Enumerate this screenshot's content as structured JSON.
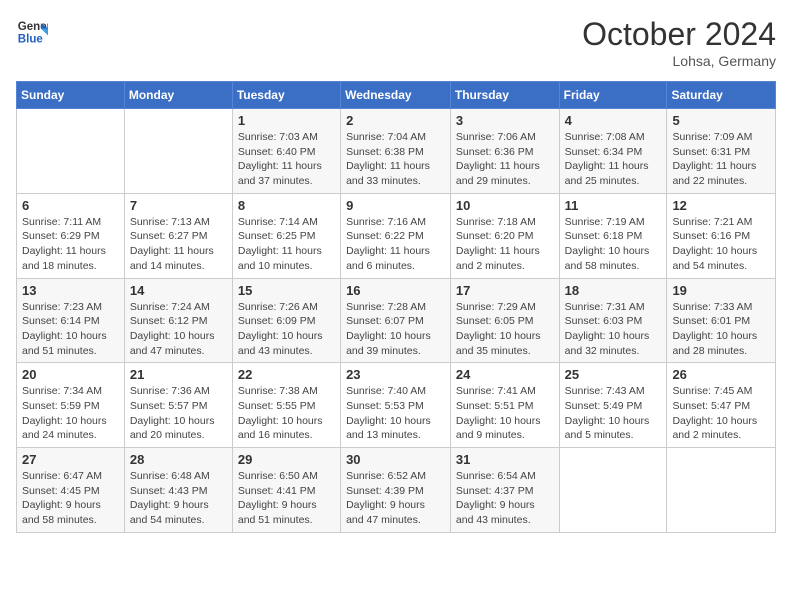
{
  "header": {
    "logo_line1": "General",
    "logo_line2": "Blue",
    "month": "October 2024",
    "location": "Lohsa, Germany"
  },
  "weekdays": [
    "Sunday",
    "Monday",
    "Tuesday",
    "Wednesday",
    "Thursday",
    "Friday",
    "Saturday"
  ],
  "weeks": [
    [
      {
        "day": "",
        "info": ""
      },
      {
        "day": "",
        "info": ""
      },
      {
        "day": "1",
        "info": "Sunrise: 7:03 AM\nSunset: 6:40 PM\nDaylight: 11 hours and 37 minutes."
      },
      {
        "day": "2",
        "info": "Sunrise: 7:04 AM\nSunset: 6:38 PM\nDaylight: 11 hours and 33 minutes."
      },
      {
        "day": "3",
        "info": "Sunrise: 7:06 AM\nSunset: 6:36 PM\nDaylight: 11 hours and 29 minutes."
      },
      {
        "day": "4",
        "info": "Sunrise: 7:08 AM\nSunset: 6:34 PM\nDaylight: 11 hours and 25 minutes."
      },
      {
        "day": "5",
        "info": "Sunrise: 7:09 AM\nSunset: 6:31 PM\nDaylight: 11 hours and 22 minutes."
      }
    ],
    [
      {
        "day": "6",
        "info": "Sunrise: 7:11 AM\nSunset: 6:29 PM\nDaylight: 11 hours and 18 minutes."
      },
      {
        "day": "7",
        "info": "Sunrise: 7:13 AM\nSunset: 6:27 PM\nDaylight: 11 hours and 14 minutes."
      },
      {
        "day": "8",
        "info": "Sunrise: 7:14 AM\nSunset: 6:25 PM\nDaylight: 11 hours and 10 minutes."
      },
      {
        "day": "9",
        "info": "Sunrise: 7:16 AM\nSunset: 6:22 PM\nDaylight: 11 hours and 6 minutes."
      },
      {
        "day": "10",
        "info": "Sunrise: 7:18 AM\nSunset: 6:20 PM\nDaylight: 11 hours and 2 minutes."
      },
      {
        "day": "11",
        "info": "Sunrise: 7:19 AM\nSunset: 6:18 PM\nDaylight: 10 hours and 58 minutes."
      },
      {
        "day": "12",
        "info": "Sunrise: 7:21 AM\nSunset: 6:16 PM\nDaylight: 10 hours and 54 minutes."
      }
    ],
    [
      {
        "day": "13",
        "info": "Sunrise: 7:23 AM\nSunset: 6:14 PM\nDaylight: 10 hours and 51 minutes."
      },
      {
        "day": "14",
        "info": "Sunrise: 7:24 AM\nSunset: 6:12 PM\nDaylight: 10 hours and 47 minutes."
      },
      {
        "day": "15",
        "info": "Sunrise: 7:26 AM\nSunset: 6:09 PM\nDaylight: 10 hours and 43 minutes."
      },
      {
        "day": "16",
        "info": "Sunrise: 7:28 AM\nSunset: 6:07 PM\nDaylight: 10 hours and 39 minutes."
      },
      {
        "day": "17",
        "info": "Sunrise: 7:29 AM\nSunset: 6:05 PM\nDaylight: 10 hours and 35 minutes."
      },
      {
        "day": "18",
        "info": "Sunrise: 7:31 AM\nSunset: 6:03 PM\nDaylight: 10 hours and 32 minutes."
      },
      {
        "day": "19",
        "info": "Sunrise: 7:33 AM\nSunset: 6:01 PM\nDaylight: 10 hours and 28 minutes."
      }
    ],
    [
      {
        "day": "20",
        "info": "Sunrise: 7:34 AM\nSunset: 5:59 PM\nDaylight: 10 hours and 24 minutes."
      },
      {
        "day": "21",
        "info": "Sunrise: 7:36 AM\nSunset: 5:57 PM\nDaylight: 10 hours and 20 minutes."
      },
      {
        "day": "22",
        "info": "Sunrise: 7:38 AM\nSunset: 5:55 PM\nDaylight: 10 hours and 16 minutes."
      },
      {
        "day": "23",
        "info": "Sunrise: 7:40 AM\nSunset: 5:53 PM\nDaylight: 10 hours and 13 minutes."
      },
      {
        "day": "24",
        "info": "Sunrise: 7:41 AM\nSunset: 5:51 PM\nDaylight: 10 hours and 9 minutes."
      },
      {
        "day": "25",
        "info": "Sunrise: 7:43 AM\nSunset: 5:49 PM\nDaylight: 10 hours and 5 minutes."
      },
      {
        "day": "26",
        "info": "Sunrise: 7:45 AM\nSunset: 5:47 PM\nDaylight: 10 hours and 2 minutes."
      }
    ],
    [
      {
        "day": "27",
        "info": "Sunrise: 6:47 AM\nSunset: 4:45 PM\nDaylight: 9 hours and 58 minutes."
      },
      {
        "day": "28",
        "info": "Sunrise: 6:48 AM\nSunset: 4:43 PM\nDaylight: 9 hours and 54 minutes."
      },
      {
        "day": "29",
        "info": "Sunrise: 6:50 AM\nSunset: 4:41 PM\nDaylight: 9 hours and 51 minutes."
      },
      {
        "day": "30",
        "info": "Sunrise: 6:52 AM\nSunset: 4:39 PM\nDaylight: 9 hours and 47 minutes."
      },
      {
        "day": "31",
        "info": "Sunrise: 6:54 AM\nSunset: 4:37 PM\nDaylight: 9 hours and 43 minutes."
      },
      {
        "day": "",
        "info": ""
      },
      {
        "day": "",
        "info": ""
      }
    ]
  ]
}
